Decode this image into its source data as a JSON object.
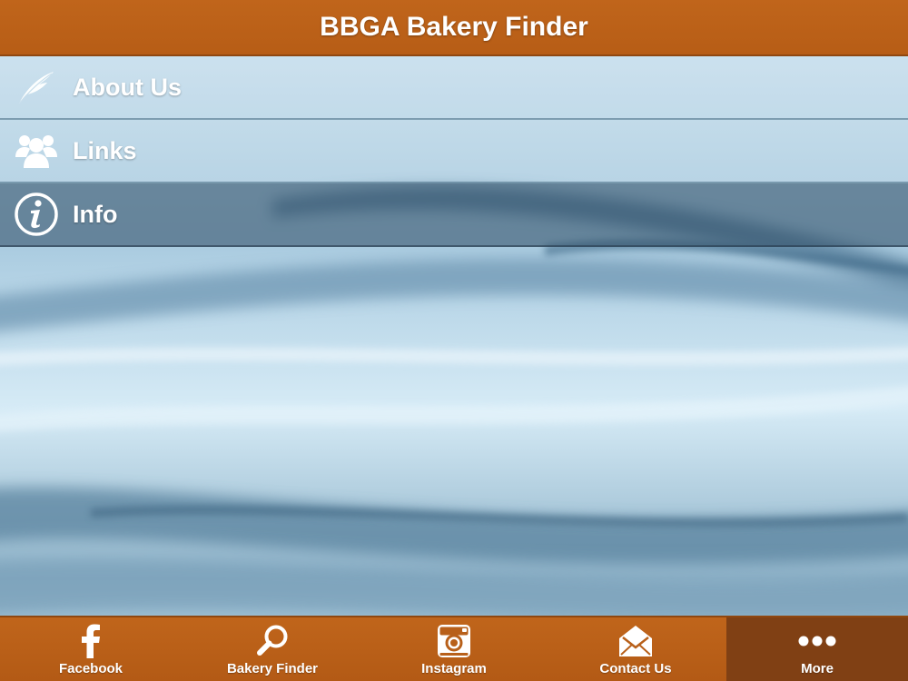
{
  "header": {
    "title": "BBGA Bakery Finder"
  },
  "colors": {
    "brand": "#b85f18",
    "brand_dark": "#804014",
    "background": "#9ec3d8"
  },
  "menu": {
    "items": [
      {
        "label": "About Us",
        "icon": "feather-icon",
        "selected": false
      },
      {
        "label": "Links",
        "icon": "people-icon",
        "selected": false
      },
      {
        "label": "Info",
        "icon": "info-icon",
        "selected": true
      }
    ]
  },
  "tabbar": {
    "tabs": [
      {
        "label": "Facebook",
        "icon": "facebook-icon",
        "active": false
      },
      {
        "label": "Bakery Finder",
        "icon": "search-icon",
        "active": false
      },
      {
        "label": "Instagram",
        "icon": "camera-icon",
        "active": false
      },
      {
        "label": "Contact Us",
        "icon": "envelope-icon",
        "active": false
      },
      {
        "label": "More",
        "icon": "more-dots-icon",
        "active": true
      }
    ]
  }
}
